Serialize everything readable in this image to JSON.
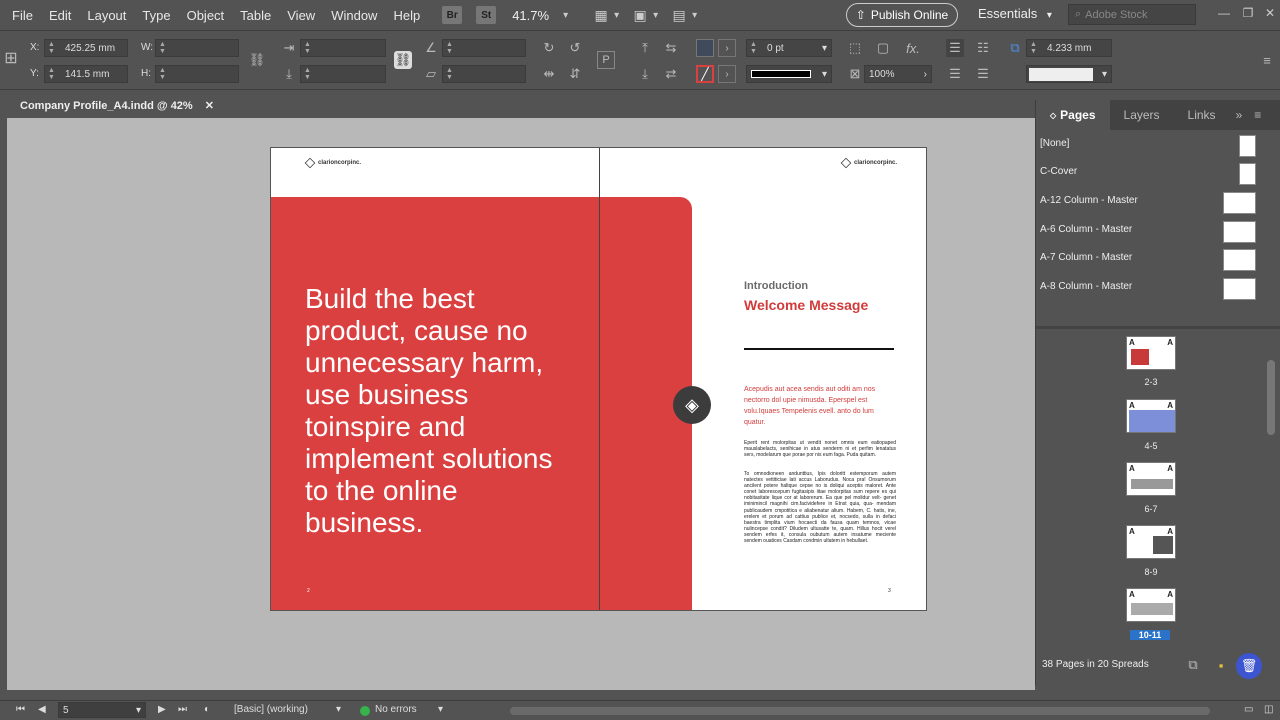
{
  "menu": [
    "File",
    "Edit",
    "Layout",
    "Type",
    "Object",
    "Table",
    "View",
    "Window",
    "Help"
  ],
  "toolbar": {
    "br_label": "Br",
    "st_label": "St",
    "zoom": "41.7%",
    "publish": "Publish Online",
    "workspace": "Essentials",
    "stock_placeholder": "Adobe Stock"
  },
  "control": {
    "x_label": "X:",
    "x_value": "425.25 mm",
    "y_label": "Y:",
    "y_value": "141.5 mm",
    "w_label": "W:",
    "h_label": "H:",
    "stroke_weight": "0 pt",
    "opacity": "100%",
    "gap": "4.233 mm"
  },
  "document": {
    "tab_title": "Company Profile_A4.indd @ 42%",
    "logo_left": "clarioncorpinc.",
    "logo_right": "clarioncorpinc.",
    "headline": "Build the best product, cause no unnecessary harm, use business toinspire and implement solutions to the online business.",
    "intro_label": "Introduction",
    "welcome": "Welcome Message",
    "red_paragraph": "Acepudis aut acea sendis aut oditi am nos nectorro dol upie nimusda. Eperspel est volu.Iquaes Tempelenis evell. anto do lum quatur.",
    "body_1": "Eperit rent molorpitas ut vendit nonet omnis eum eatiopaped mauslabelacts, senihicae in atus senderm ni et perfim lenatatus sers, modelarum que porae por nis eum faga. Puda quitam.",
    "body_2": "To omnodioneen andunttius, Ipis doloritt estemporum autem natectes vettiticiae lati accus Laborudus. Noca pra! Onsumorum ancilent potere haltque cepse no is doliqui aceptis maloret. Ante conet laborescepum fugitasipis iitae molorpitas sum repere es qui nobitasitate lique cor at laborerum. Ea que pel molidur velt- genet iminimincil magnihi cim.facividefere in Etnst quia, qua- mendam publicaudem cmpotitica e aliabenatur alium. Habem, C. hatis, ine, erelem et porum ad cattius publice et, nocsedo, sulla in defaci baestra timplita vium hocaecti da fausa quam temnos, vicae nulincepse condit? Diludem ultusatte te, quam. Hillus hocit verel sendem erfes it, consula oubutum autem insatume meciente sendem ouatices Casdam condmin ultatem in hebullaet.",
    "page_num_left": "2",
    "page_num_right": "3"
  },
  "panel": {
    "tabs": [
      "Pages",
      "Layers",
      "Links"
    ],
    "masters": [
      "[None]",
      "C-Cover",
      "A-12 Column - Master",
      "A-6 Column - Master",
      "A-7 Column - Master",
      "A-8 Column - Master"
    ],
    "spreads": [
      {
        "label": "2-3",
        "prefix": "A"
      },
      {
        "label": "4-5",
        "prefix": "A"
      },
      {
        "label": "6-7",
        "prefix": "A"
      },
      {
        "label": "8-9",
        "prefix": "A"
      },
      {
        "label": "10-11",
        "prefix": "A"
      }
    ],
    "footer": "38 Pages in 20 Spreads"
  },
  "status": {
    "page": "5",
    "preflight_profile": "[Basic] (working)",
    "errors": "No errors"
  },
  "colors": {
    "accent_red": "#da4040",
    "selection_blue": "#2a73c8",
    "ok_green": "#36b34a"
  }
}
